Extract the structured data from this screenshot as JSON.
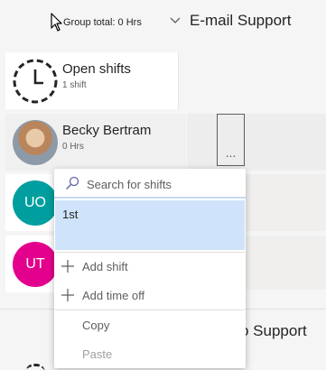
{
  "header": {
    "group_total": "Group total: 0 Hrs",
    "group_title": "E-mail Support"
  },
  "members": [
    {
      "name": "Open shifts",
      "sub": "1 shift",
      "avatar": "clock-dashed-icon"
    },
    {
      "name": "Becky Bertram",
      "sub": "0 Hrs",
      "avatar": "photo"
    },
    {
      "initials": "UO",
      "color": "#009e9e"
    },
    {
      "initials": "UT",
      "color": "#e3008c"
    }
  ],
  "more_button": {
    "label": "..."
  },
  "menu": {
    "search_placeholder": "Search for shifts",
    "result": "1st",
    "items": [
      {
        "label": "Add shift",
        "icon": "plus-icon"
      },
      {
        "label": "Add time off",
        "icon": "plus-icon"
      },
      {
        "label": "Copy"
      },
      {
        "label": "Paste",
        "disabled": true
      }
    ]
  },
  "bottom_group": {
    "title_partial": "o Support"
  },
  "colors": {
    "accent": "#0078d4",
    "selection": "#cfe4fa",
    "uo": "#009e9e",
    "ut": "#e3008c"
  }
}
